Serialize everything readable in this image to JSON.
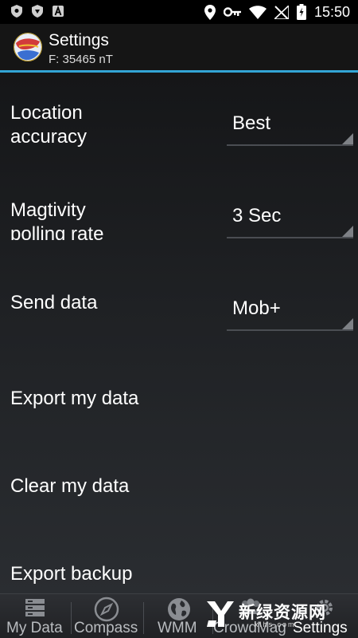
{
  "status_bar": {
    "time": "15:50",
    "left_icons": [
      "shield-icon",
      "shield-icon",
      "a-letter-icon"
    ],
    "right_icons": [
      "location-pin-icon",
      "key-icon",
      "wifi-icon",
      "no-signal-icon",
      "battery-charging-icon"
    ]
  },
  "action_bar": {
    "title": "Settings",
    "subtitle": "F: 35465 nT",
    "accent_color": "#33a5d6"
  },
  "settings": {
    "location_accuracy": {
      "label_line1": "Location",
      "label_line2": "accuracy",
      "value": "Best"
    },
    "polling_rate": {
      "label_line1": "Magtivity",
      "label_line2": "polling rate",
      "value": "3 Sec"
    },
    "send_data": {
      "label": "Send data",
      "value": "Mob+"
    },
    "export_data": {
      "label": "Export my data"
    },
    "clear_data": {
      "label": "Clear my data"
    },
    "export_backup": {
      "label": "Export backup"
    }
  },
  "tabs": [
    {
      "label": "My Data",
      "icon": "database-icon"
    },
    {
      "label": "Compass",
      "icon": "compass-icon"
    },
    {
      "label": "WMM",
      "icon": "globe-icon"
    },
    {
      "label": "CrowdMag",
      "icon": "crowd-icon"
    },
    {
      "label": "Settings",
      "icon": "gear-icon",
      "selected": true
    }
  ],
  "watermark": {
    "text": "新绿资源网",
    "url": "xlhs.com"
  }
}
